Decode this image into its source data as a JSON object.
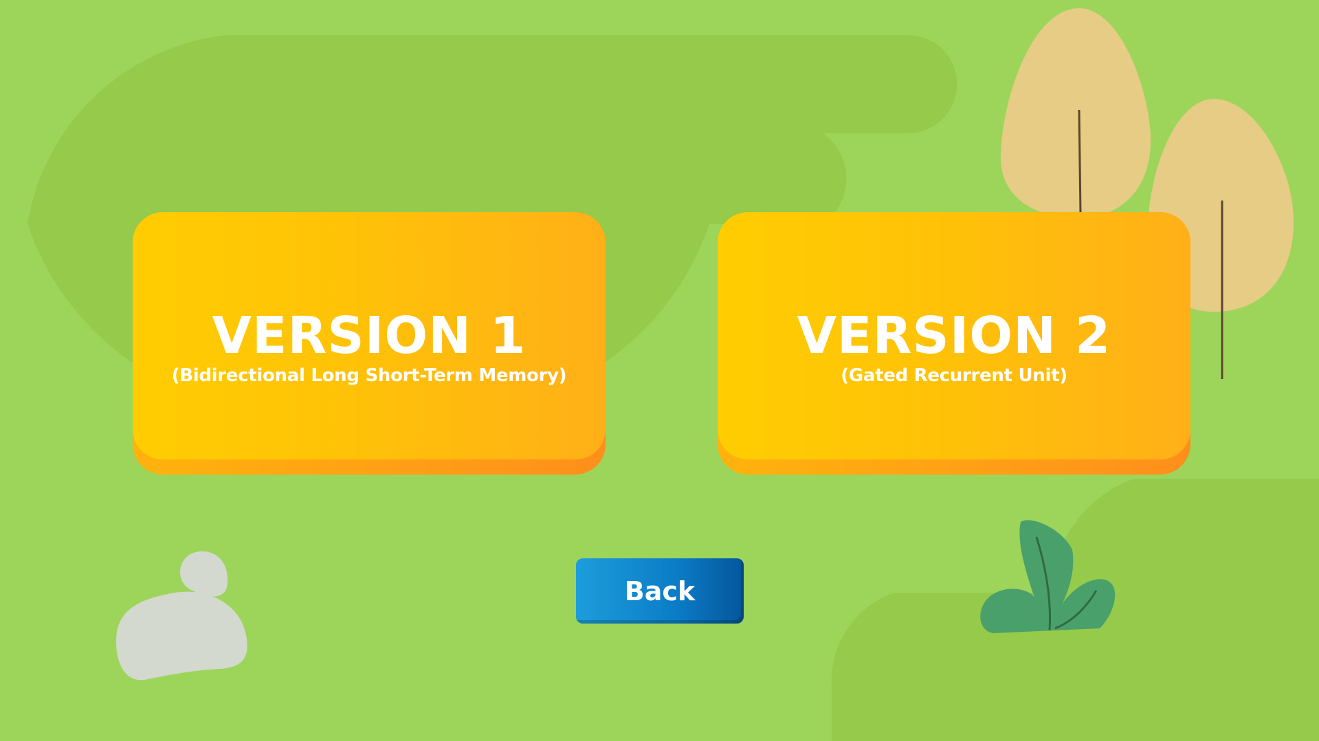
{
  "cards": [
    {
      "title": "VERSION 1",
      "subtitle": "(Bidirectional Long Short-Term Memory)"
    },
    {
      "title": "VERSION 2",
      "subtitle": "(Gated Recurrent Unit)"
    }
  ],
  "back_label": "Back",
  "colors": {
    "background": "#9dd55b",
    "background_shape": "#95ca4b",
    "card_gradient_start": "#ffcd02",
    "card_gradient_end": "#ffb018",
    "card_edge": "#ff8f1c",
    "back_button": "#0b7cc7",
    "tree": "#e6cc84",
    "bush": "#4aa06a",
    "rock": "#d3d9cf"
  },
  "icons": [
    "tree-icon",
    "bush-icon",
    "rock-icon"
  ]
}
